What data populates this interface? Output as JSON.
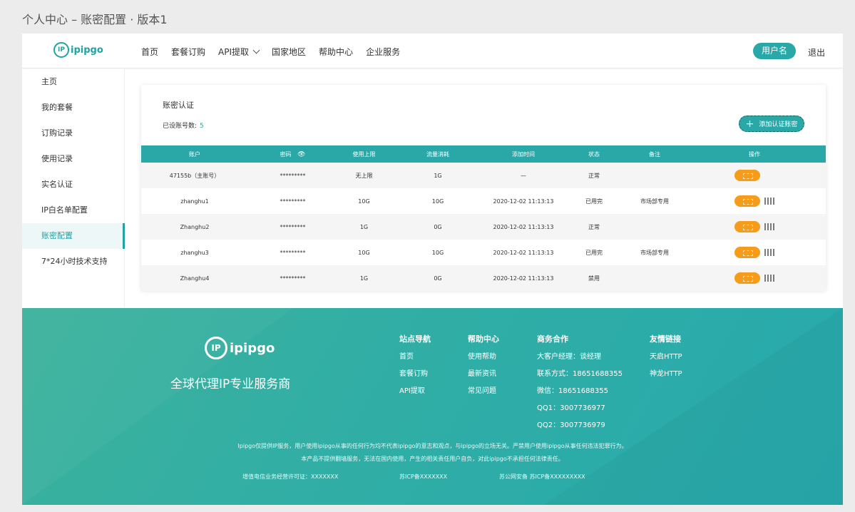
{
  "frame_title": "个人中心 – 账密配置 · 版本1",
  "brand": {
    "logo_text": "ipipgo",
    "logo_mark": "IP"
  },
  "nav": {
    "items": [
      "首页",
      "套餐订购",
      "API提取",
      "国家地区",
      "帮助中心",
      "企业服务"
    ],
    "user_label": "用户名",
    "logout_label": "退出"
  },
  "sidebar": {
    "items": [
      "主页",
      "我的套餐",
      "订购记录",
      "使用记录",
      "实名认证",
      "IP白名单配置",
      "账密配置",
      "7*24小时技术支持"
    ],
    "active_index": 6
  },
  "main": {
    "title": "账密认证",
    "count_label": "已设账号数:",
    "count_value": "5",
    "add_button": "添加认证账密",
    "columns": [
      "账户",
      "密码",
      "使用上限",
      "流量消耗",
      "添加时间",
      "状态",
      "备注",
      "操作"
    ],
    "rows": [
      {
        "account": "47155b（主账号）",
        "password": "*********",
        "limit": "无上限",
        "usage": "1G",
        "time": "—",
        "status": "正常",
        "note": "",
        "has_qr": false
      },
      {
        "account": "zhanghu1",
        "password": "*********",
        "limit": "10G",
        "usage": "10G",
        "time": "2020-12-02 11:13:13",
        "status": "已用完",
        "note": "市场部专用",
        "has_qr": true
      },
      {
        "account": "Zhanghu2",
        "password": "*********",
        "limit": "1G",
        "usage": "0G",
        "time": "2020-12-02 11:13:13",
        "status": "正常",
        "note": "",
        "has_qr": true
      },
      {
        "account": "zhanghu3",
        "password": "*********",
        "limit": "10G",
        "usage": "10G",
        "time": "2020-12-02 11:13:13",
        "status": "已用完",
        "note": "市场部专用",
        "has_qr": true
      },
      {
        "account": "Zhanghu4",
        "password": "*********",
        "limit": "1G",
        "usage": "0G",
        "time": "2020-12-02 11:13:13",
        "status": "禁用",
        "note": "",
        "has_qr": true
      }
    ]
  },
  "footer": {
    "logo_text": "ipipgo",
    "slogan": "全球代理IP专业服务商",
    "columns": [
      {
        "heading": "站点导航",
        "items": [
          "首页",
          "套餐订购",
          "API提取"
        ]
      },
      {
        "heading": "帮助中心",
        "items": [
          "使用帮助",
          "最新资讯",
          "常见问题"
        ]
      },
      {
        "heading": "商务合作",
        "items": [
          "大客户经理：谈经理",
          "联系方式：18651688355",
          "微信：18651688355",
          "QQ1：3007736977",
          "QQ2：3007736979"
        ]
      },
      {
        "heading": "友情链接",
        "items": [
          "天启HTTP",
          "神龙HTTP"
        ]
      }
    ],
    "notice1": "Ipipgo仅提供IP服务，用户使用ipipgo从事的任何行为均不代表ipipgo的意志和观点，与ipipgo的立场无关。严禁用户使用ipipgo从事任何违法犯罪行为。",
    "notice2": "本产品不提供翻墙服务，无法在国内使用，产生的相关责任用户自负，对此ipipgo不承担任何法律责任。",
    "license1": "增值电信业务经营许可证：XXXXXXX",
    "license2": "苏ICP备XXXXXXX",
    "license3": "苏公网安备 苏ICP备XXXXXXXXX"
  },
  "colors": {
    "accent": "#2aa7a7",
    "orange": "#f59c1a",
    "footer_from": "#3cb19c",
    "footer_to": "#27a9ad"
  }
}
